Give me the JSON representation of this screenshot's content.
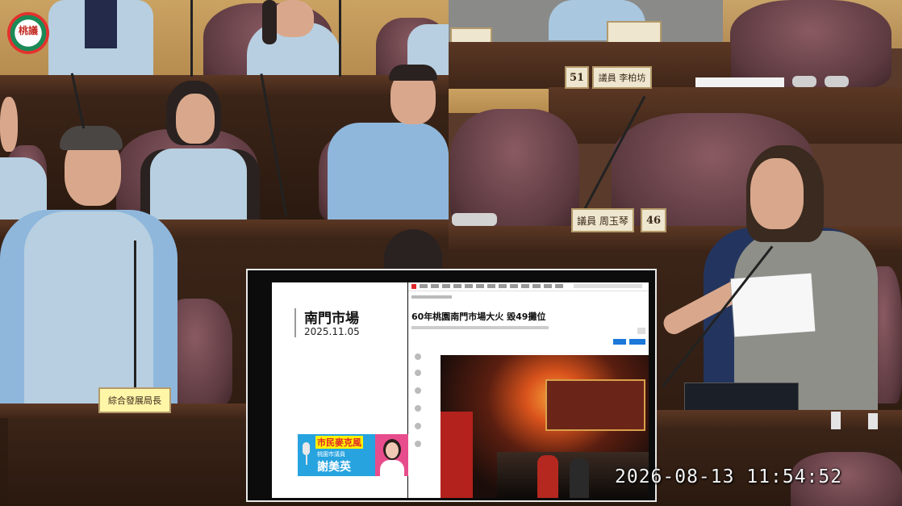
{
  "broadcast": {
    "logo_text": "桃議",
    "timestamp": "2026-08-13  11:54:52"
  },
  "name_plates": {
    "official_title": "綜合發展局長",
    "councilor_1_number": "51",
    "councilor_1_name": "議員 李柏坊",
    "councilor_2_number": "46",
    "councilor_2_name": "議員 周玉琴"
  },
  "slide": {
    "title": "南門市場",
    "date": "2025.11.05",
    "headline": "60年桃園南門市場大火 毀49攤位",
    "banner_line1": "市民麥克風",
    "banner_line2": "桃園市議員",
    "banner_line3": "謝美英"
  },
  "colors": {
    "accent_red": "#e0262a",
    "banner_blue": "#27a3e0",
    "banner_pink": "#e74d8c"
  }
}
